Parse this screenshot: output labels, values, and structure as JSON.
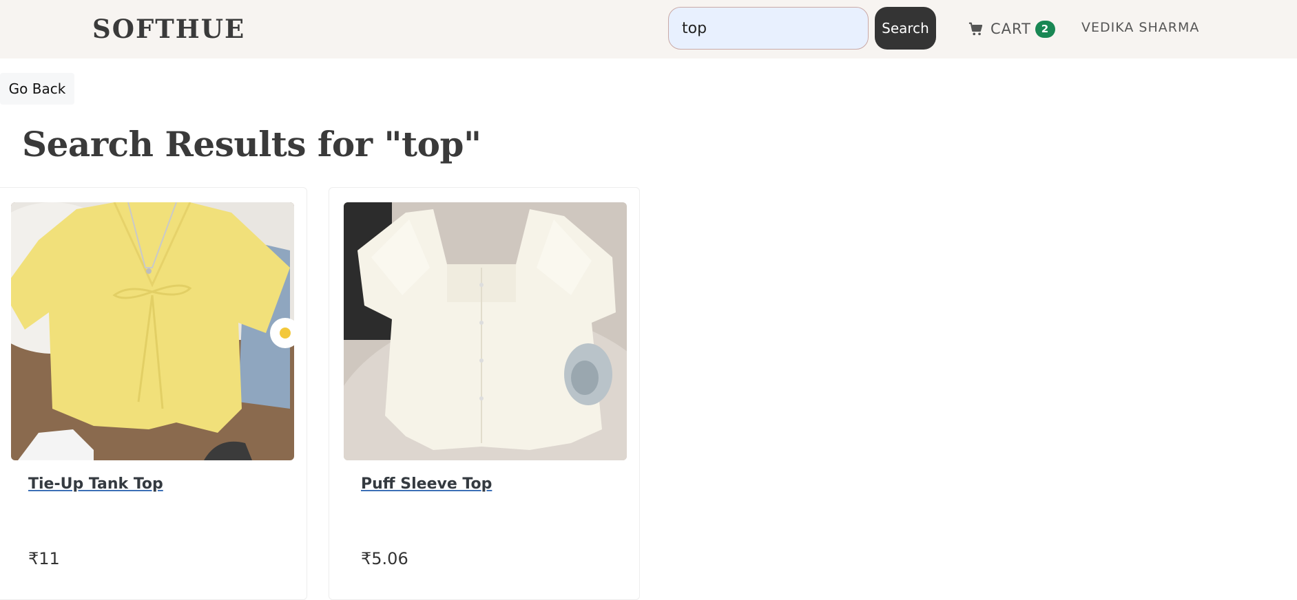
{
  "navbar": {
    "brand": "SOFTHUE",
    "search_value": "top",
    "search_button": "Search",
    "cart_label": "CART",
    "cart_count": "2",
    "user_name": "VEDIKA SHARMA"
  },
  "page": {
    "back_label": "Go Back",
    "title": "Search Results for \"top\""
  },
  "products": [
    {
      "name": "Tie-Up Tank Top",
      "price": "₹11"
    },
    {
      "name": "Puff Sleeve Top",
      "price": "₹5.06"
    }
  ],
  "colors": {
    "navbar_bg": "#f7f4f1",
    "search_bg": "#e8f0fe",
    "button_bg": "#343434",
    "badge_bg": "#198754"
  },
  "icons": {
    "cart": "shopping-cart-icon"
  }
}
